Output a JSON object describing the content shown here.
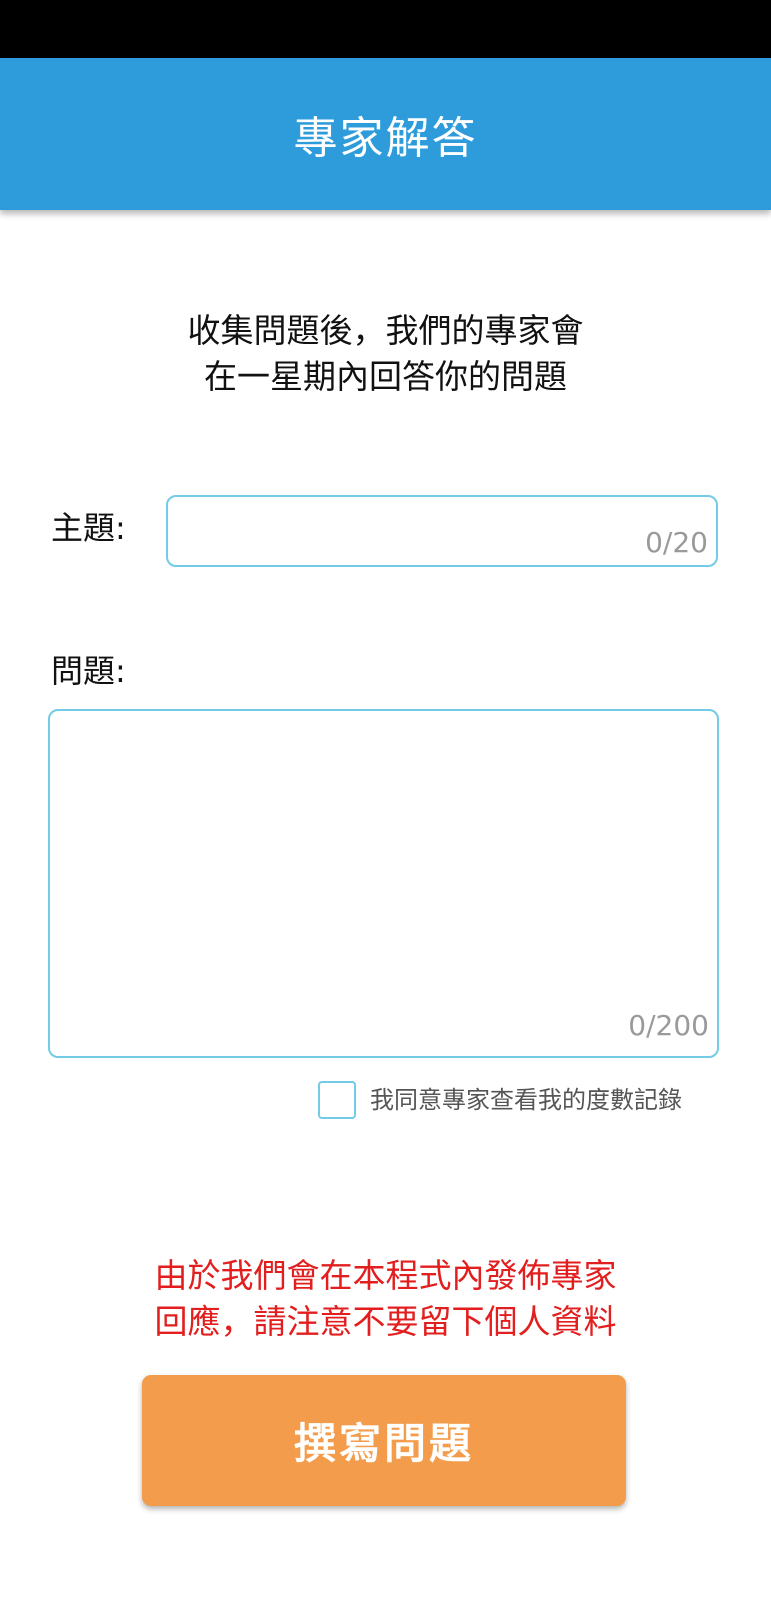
{
  "app_bar": {
    "title": "專家解答"
  },
  "intro": {
    "line1": "收集問題後，我們的專家會",
    "line2": "在一星期內回答你的問題"
  },
  "form": {
    "subject": {
      "label": "主題:",
      "value": "",
      "counter": "0/20"
    },
    "question": {
      "label": "問題:",
      "value": "",
      "counter": "0/200"
    },
    "consent": {
      "checked": false,
      "label": "我同意專家查看我的度數記錄"
    }
  },
  "warning": {
    "line1": "由於我們會在本程式內發佈專家",
    "line2": "回應，請注意不要留下個人資料"
  },
  "submit": {
    "label": "撰寫問題"
  },
  "colors": {
    "app_bar": "#2e9cdb",
    "input_border": "#72cce6",
    "warning_text": "#e21e1e",
    "button": "#f39c4b"
  }
}
